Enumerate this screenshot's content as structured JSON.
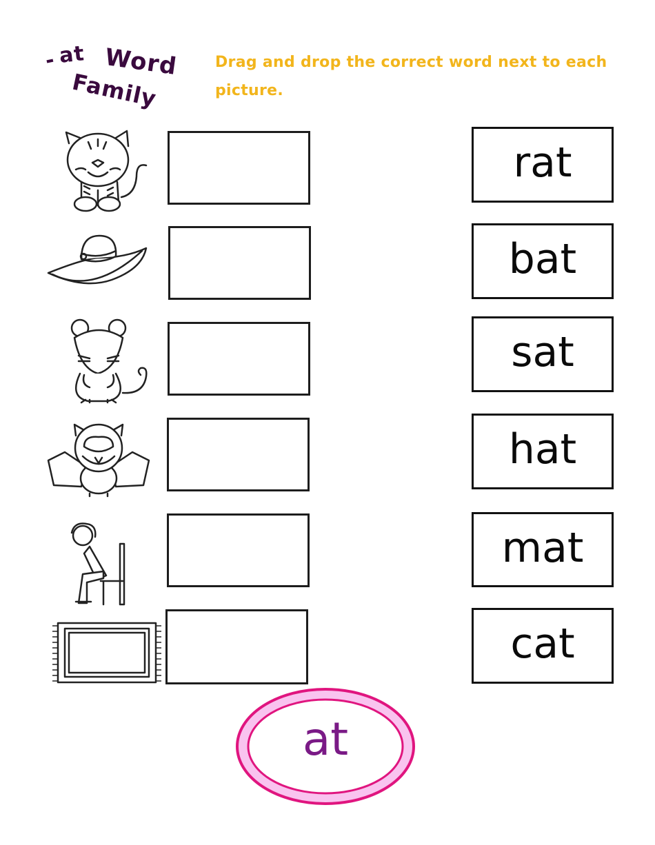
{
  "header": {
    "title_line1_dash": "-",
    "title_line1_word1": "at",
    "title_line1_word2": "Word",
    "title_line2": "Family",
    "instructions": "Drag and drop the correct word next to each picture."
  },
  "pictures": [
    {
      "name": "cat",
      "icon": "cat-icon"
    },
    {
      "name": "hat",
      "icon": "hat-icon"
    },
    {
      "name": "rat",
      "icon": "rat-icon"
    },
    {
      "name": "bat",
      "icon": "bat-icon"
    },
    {
      "name": "sat",
      "icon": "sitting-boy-icon"
    },
    {
      "name": "mat",
      "icon": "mat-icon"
    }
  ],
  "drop_zones": [
    "",
    "",
    "",
    "",
    "",
    ""
  ],
  "word_cards": [
    "rat",
    "bat",
    "sat",
    "hat",
    "mat",
    "cat"
  ],
  "family_badge": {
    "label": "at",
    "border_color": "#e0157f",
    "fill_color": "#f9c3ef",
    "text_color": "#7a1a86"
  },
  "colors": {
    "title": "#3a0a3e",
    "instructions": "#f2b51c"
  }
}
